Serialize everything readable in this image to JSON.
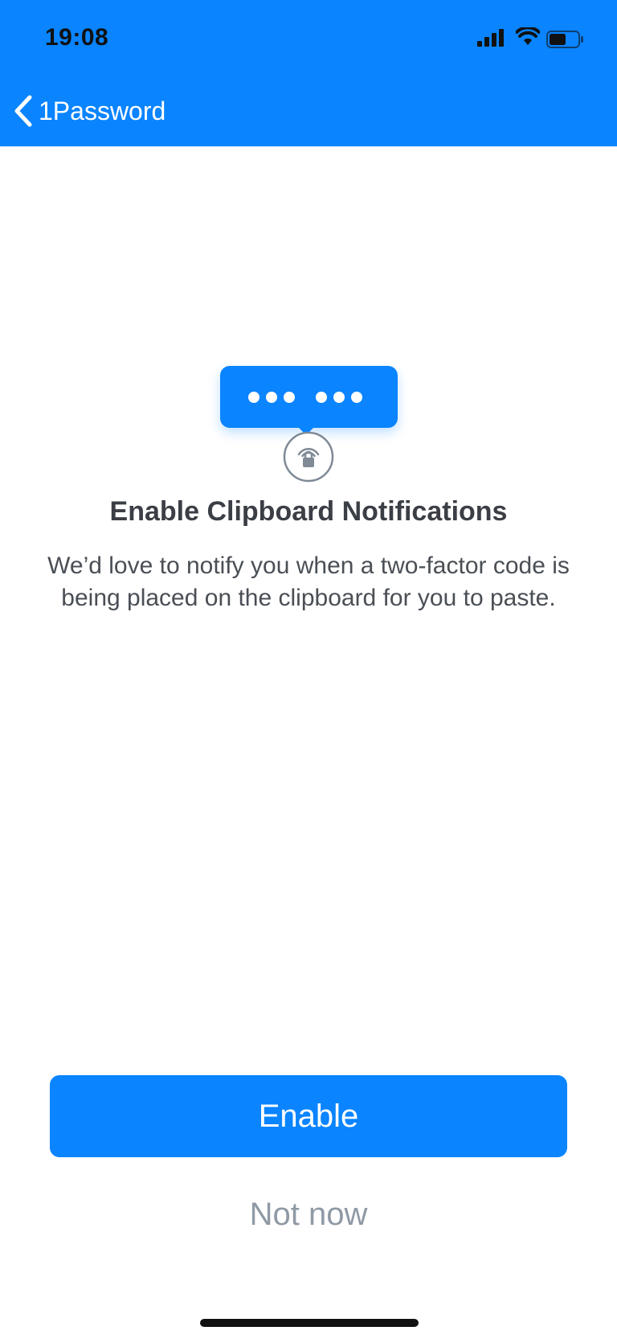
{
  "status_bar": {
    "time": "19:08",
    "icons": [
      "cellular-signal-icon",
      "wifi-icon",
      "battery-icon"
    ]
  },
  "nav": {
    "back_label": "1Password",
    "back_icon": "chevron-left-icon"
  },
  "illustration": {
    "bubble_icon": "password-dots-icon",
    "badge_icon": "lock-broadcast-icon"
  },
  "content": {
    "title": "Enable Clipboard Notifications",
    "description": "We’d love to notify you when a two-factor code is being placed on the clipboard for you to paste."
  },
  "actions": {
    "enable_label": "Enable",
    "not_now_label": "Not now"
  },
  "colors": {
    "accent": "#0a84ff",
    "title_text": "#3b3f45",
    "body_text": "#4a4f56",
    "secondary_text": "#8f9aa5"
  }
}
